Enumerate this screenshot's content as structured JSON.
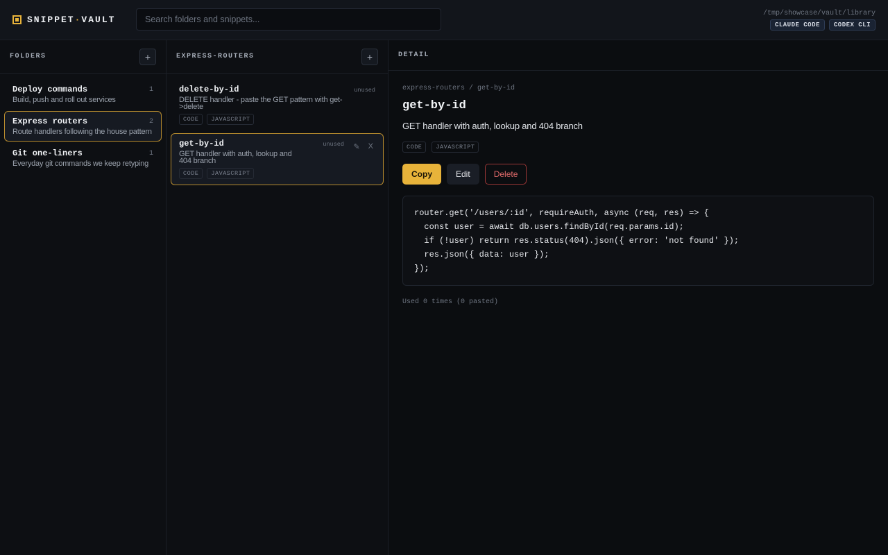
{
  "app": {
    "brand_left": "SNIPPET",
    "brand_dot": "·",
    "brand_right": "VAULT",
    "search_placeholder": "Search folders and snippets...",
    "path": "/tmp/showcase/vault/library",
    "agents": [
      "CLAUDE CODE",
      "CODEX CLI"
    ]
  },
  "folders": {
    "title": "FOLDERS",
    "add_label": "+",
    "items": [
      {
        "name": "Deploy commands",
        "desc": "Build, push and roll out services",
        "count": "1"
      },
      {
        "name": "Express routers",
        "desc": "Route handlers following the house pattern",
        "count": "2"
      },
      {
        "name": "Git one-liners",
        "desc": "Everyday git commands we keep retyping",
        "count": "1"
      }
    ]
  },
  "snippets": {
    "title": "EXPRESS-ROUTERS",
    "add_label": "+",
    "items": [
      {
        "name": "delete-by-id",
        "desc": "DELETE handler - paste the GET pattern with get->delete",
        "status": "unused",
        "tags": [
          "CODE",
          "JAVASCRIPT"
        ]
      },
      {
        "name": "get-by-id",
        "desc": "GET handler with auth, lookup and 404 branch",
        "status": "unused",
        "tags": [
          "CODE",
          "JAVASCRIPT"
        ],
        "edit_glyph": "✎",
        "close_glyph": "X"
      }
    ]
  },
  "detail": {
    "title": "DETAIL",
    "crumb": "express-routers / get-by-id",
    "name": "get-by-id",
    "desc": "GET handler with auth, lookup and 404 branch",
    "tags": [
      "CODE",
      "JAVASCRIPT"
    ],
    "copy_label": "Copy",
    "edit_label": "Edit",
    "delete_label": "Delete",
    "code": [
      "router.get('/users/:id', requireAuth, async (req, res) => {",
      "  const user = await db.users.findById(req.params.id);",
      "  if (!user) return res.status(404).json({ error: 'not found' });",
      "  res.json({ data: user });",
      "});"
    ],
    "usage": "Used 0 times (0 pasted)"
  },
  "colors": {
    "accent": "#e8b33a",
    "danger": "#e06a6a",
    "background": "#0c0e12"
  }
}
